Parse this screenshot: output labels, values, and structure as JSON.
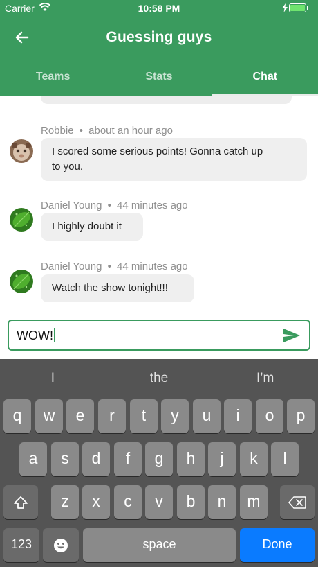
{
  "status_bar": {
    "carrier": "Carrier",
    "time": "10:58 PM"
  },
  "header": {
    "title": "Guessing guys"
  },
  "tabs": [
    {
      "label": "Teams",
      "active": false
    },
    {
      "label": "Stats",
      "active": false
    },
    {
      "label": "Chat",
      "active": true
    }
  ],
  "messages": [
    {
      "author": "Robbie",
      "time": "about an hour ago",
      "text_lines": [
        "I scored some serious points! Gonna catch up",
        "to you."
      ]
    },
    {
      "author": "Daniel Young",
      "time": "44 minutes ago",
      "text_lines": [
        "I highly doubt it"
      ]
    },
    {
      "author": "Daniel Young",
      "time": "44 minutes ago",
      "text_lines": [
        "Watch the show tonight!!!"
      ]
    }
  ],
  "input": {
    "value": "WOW!"
  },
  "keyboard": {
    "suggestions": [
      "I",
      "the",
      "I’m"
    ],
    "row1": [
      "q",
      "w",
      "e",
      "r",
      "t",
      "y",
      "u",
      "i",
      "o",
      "p"
    ],
    "row2": [
      "a",
      "s",
      "d",
      "f",
      "g",
      "h",
      "j",
      "k",
      "l"
    ],
    "row3": [
      "z",
      "x",
      "c",
      "v",
      "b",
      "n",
      "m"
    ],
    "numbers_label": "123",
    "space_label": "space",
    "done_label": "Done"
  },
  "colors": {
    "accent": "#3a9b5e",
    "done": "#0a7bff"
  }
}
